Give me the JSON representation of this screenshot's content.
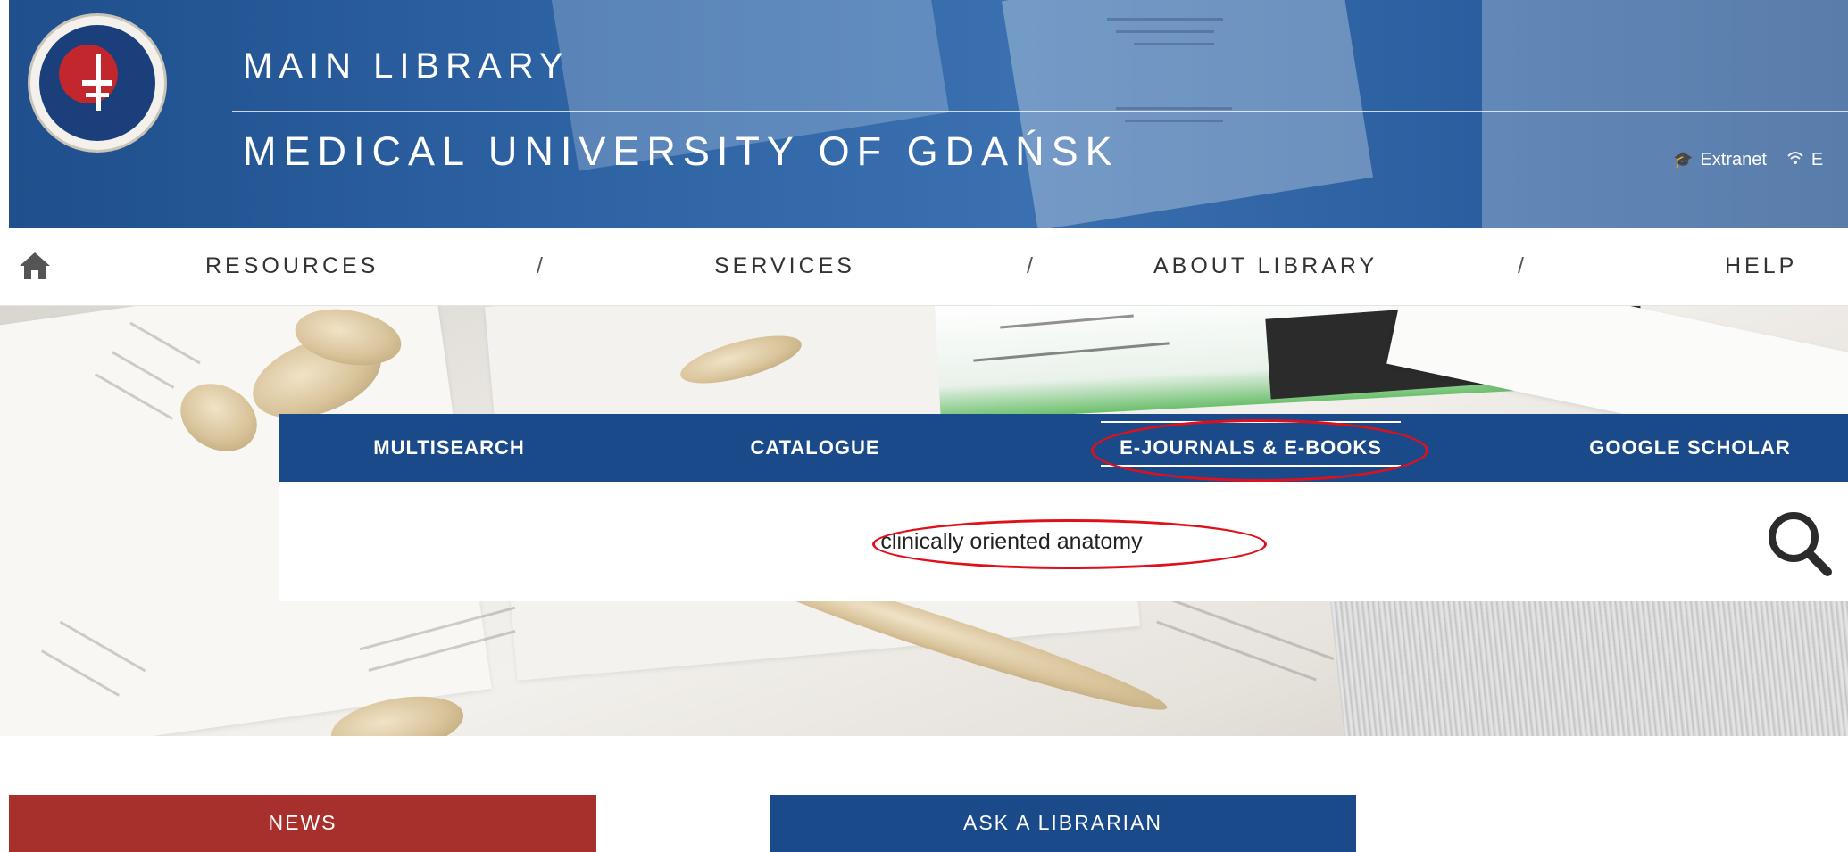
{
  "header": {
    "title_line1": "MAIN LIBRARY",
    "title_line2": "MEDICAL UNIVERSITY OF GDAŃSK",
    "links": [
      {
        "label": "Extranet",
        "icon": "graduation-cap-icon"
      },
      {
        "label": "E",
        "icon": "wifi-icon"
      }
    ]
  },
  "nav": {
    "home_icon": "home-icon",
    "items": [
      {
        "label": "RESOURCES"
      },
      {
        "label": "SERVICES"
      },
      {
        "label": "ABOUT LIBRARY"
      },
      {
        "label": "HELP"
      }
    ],
    "separator": "/"
  },
  "search": {
    "tabs": [
      {
        "label": "MULTISEARCH",
        "active": false
      },
      {
        "label": "CATALOGUE",
        "active": false
      },
      {
        "label": "E-JOURNALS & E-BOOKS",
        "active": true
      },
      {
        "label": "GOOGLE SCHOLAR",
        "active": false
      }
    ],
    "query": "clinically oriented anatomy",
    "button_icon": "magnifier-icon"
  },
  "bottom": {
    "news_label": "NEWS",
    "ask_label": "ASK A LIBRARIAN"
  },
  "colors": {
    "header_blue": "#2d62a3",
    "tab_blue": "#1b4a8a",
    "news_red": "#a8302c",
    "annotation_red": "#e0101a"
  }
}
